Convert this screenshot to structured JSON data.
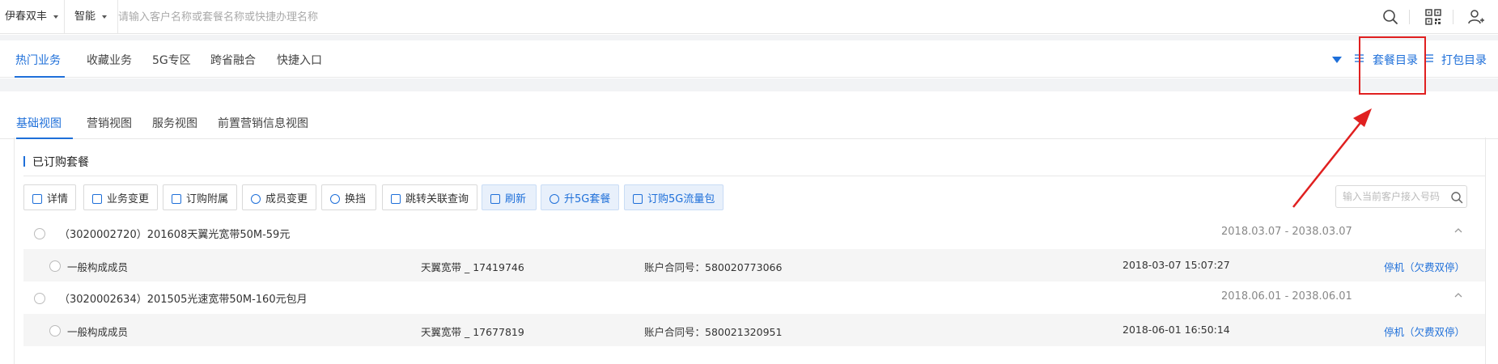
{
  "topbar": {
    "region": "伊春双丰",
    "mode": "智能",
    "search_placeholder": "请输入客户名称或套餐名称或快捷办理名称"
  },
  "nav": {
    "tabs": [
      {
        "label": "热门业务"
      },
      {
        "label": "收藏业务"
      },
      {
        "label": "5G专区"
      },
      {
        "label": "跨省融合"
      },
      {
        "label": "快捷入口"
      }
    ],
    "right_links": [
      {
        "label": "套餐目录"
      },
      {
        "label": "打包目录"
      }
    ]
  },
  "views": {
    "tabs": [
      {
        "label": "基础视图"
      },
      {
        "label": "营销视图"
      },
      {
        "label": "服务视图"
      },
      {
        "label": "前置营销信息视图"
      }
    ]
  },
  "section": {
    "title": "已订购套餐",
    "buttons": [
      {
        "label": "详情"
      },
      {
        "label": "业务变更"
      },
      {
        "label": "订购附属"
      },
      {
        "label": "成员变更"
      },
      {
        "label": "换挡"
      },
      {
        "label": "跳转关联查询"
      },
      {
        "label": "刷新"
      },
      {
        "label": "升5G套餐"
      },
      {
        "label": "订购5G流量包"
      }
    ],
    "customer_input_placeholder": "输入当前客户接入号码"
  },
  "packages": [
    {
      "name": "（3020002720）201608天翼光宽带50M-59元",
      "dates": "2018.03.07 - 2038.03.07",
      "member": {
        "role": "一般构成成员",
        "product": "天翼宽带 _ 17419746",
        "contract": "账户合同号：580020773066",
        "time": "2018-03-07 15:07:27",
        "status": "停机（欠费双停）"
      }
    },
    {
      "name": "（3020002634）201505光速宽带50M-160元包月",
      "dates": "2018.06.01 - 2038.06.01",
      "member": {
        "role": "一般构成成员",
        "product": "天翼宽带 _ 17677819",
        "contract": "账户合同号：580021320951",
        "time": "2018-06-01 16:50:14",
        "status": "停机（欠费双停）"
      }
    }
  ],
  "colors": {
    "accent": "#1e6fd9",
    "annotation": "#e02020",
    "gap": "#f2f3f5"
  }
}
